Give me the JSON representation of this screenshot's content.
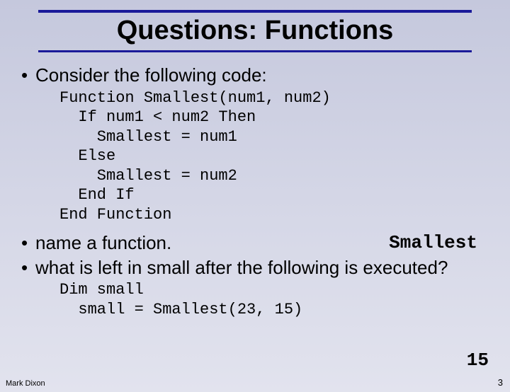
{
  "title": "Questions: Functions",
  "bullets": {
    "b1": "Consider the following code:",
    "b2": "name a function.",
    "b3": "what is left in small after the following is executed?"
  },
  "code1": "Function Smallest(num1, num2)\n  If num1 < num2 Then\n    Smallest = num1\n  Else\n    Smallest = num2\n  End If\nEnd Function",
  "code2": "Dim small\n  small = Smallest(23, 15)",
  "answers": {
    "a1": "Smallest",
    "a2": "15"
  },
  "footer": {
    "author": "Mark Dixon",
    "page": "3"
  }
}
